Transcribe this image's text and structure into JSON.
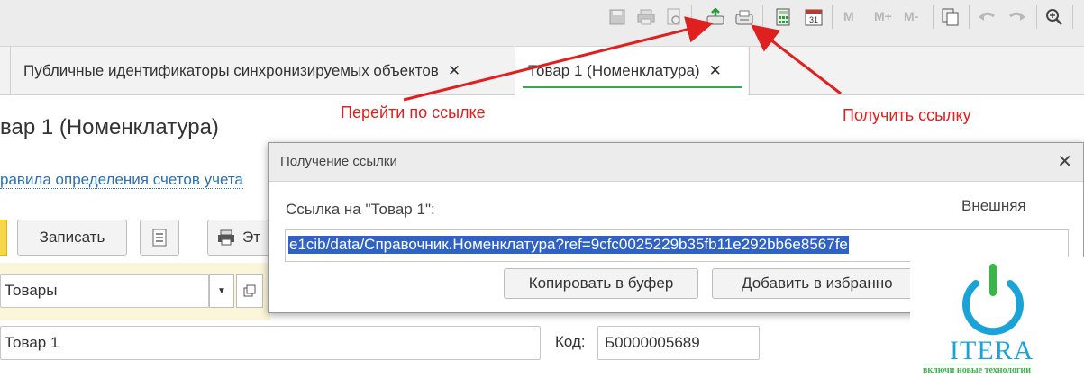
{
  "toolbar": {
    "icons": [
      "save-icon",
      "print-icon",
      "preview-icon",
      "go-to-link-icon",
      "get-link-icon",
      "calculator-icon",
      "calendar-icon",
      "copy-icon",
      "undo-icon",
      "redo-icon",
      "zoom-icon"
    ],
    "calendar_day": "31",
    "memory_buttons": [
      "M",
      "M+",
      "M-"
    ]
  },
  "tabs": [
    {
      "label": "Публичные идентификаторы синхронизируемых объектов",
      "close": "✕"
    },
    {
      "label": "Товар 1 (Номенклатура)",
      "close": "✕",
      "active": true
    }
  ],
  "annotations": {
    "goto_link": "Перейти по ссылке",
    "get_link": "Получить ссылку",
    "color": "#e01f1f"
  },
  "form": {
    "title": "вар 1 (Номенклатура)",
    "link_text": "равила определения счетов учета",
    "write_button": "Записать",
    "print_button_partial": "Эт",
    "group_field": "Товары",
    "name_field": "Товар 1",
    "code_label": "Код:",
    "code_value": "Б0000005689"
  },
  "dialog": {
    "title": "Получение ссылки",
    "close": "✕",
    "label": "Ссылка на \"Товар 1\":",
    "type": "Внешняя",
    "url": "e1cib/data/Справочник.Номенклатура?ref=9cfc0025229b35fb11e292bb6e8567fe",
    "copy_button": "Копировать в буфер",
    "favorites_button": "Добавить в избранно"
  },
  "logo": {
    "name": "ITERA",
    "slogan": "включи новые технологии"
  },
  "colors": {
    "accent_green": "#3aa65a",
    "selection_blue": "#2f62c4",
    "link_blue": "#2a6fb3",
    "logo_blue": "#1aa3d9",
    "logo_green": "#3bb54a"
  }
}
